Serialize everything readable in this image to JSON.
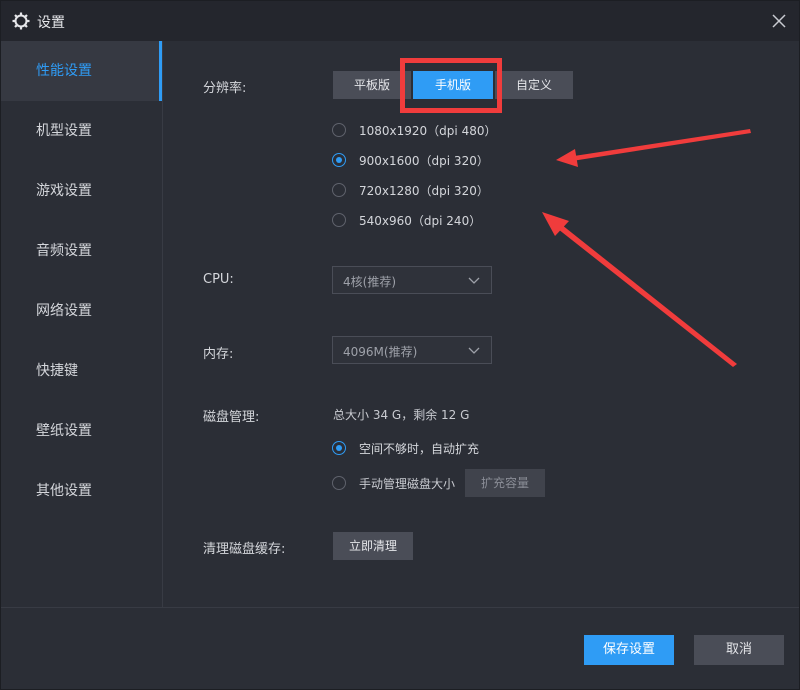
{
  "window": {
    "title": "设置"
  },
  "sidebar": {
    "items": [
      {
        "label": "性能设置",
        "active": true
      },
      {
        "label": "机型设置"
      },
      {
        "label": "游戏设置"
      },
      {
        "label": "音频设置"
      },
      {
        "label": "网络设置"
      },
      {
        "label": "快捷键"
      },
      {
        "label": "壁纸设置"
      },
      {
        "label": "其他设置"
      }
    ]
  },
  "resolution": {
    "label": "分辨率:",
    "modes": [
      "平板版",
      "手机版",
      "自定义"
    ],
    "selected_mode": "手机版",
    "options": [
      {
        "label": "1080x1920（dpi 480）",
        "checked": false
      },
      {
        "label": "900x1600（dpi 320）",
        "checked": true
      },
      {
        "label": "720x1280（dpi 320）",
        "checked": false
      },
      {
        "label": "540x960（dpi 240）",
        "checked": false
      }
    ]
  },
  "cpu": {
    "label": "CPU:",
    "value": "4核(推荐)"
  },
  "memory": {
    "label": "内存:",
    "value": "4096M(推荐)"
  },
  "disk": {
    "label": "磁盘管理:",
    "info": "总大小 34 G，剩余 12 G",
    "options": [
      {
        "label": "空间不够时，自动扩充",
        "checked": true
      },
      {
        "label": "手动管理磁盘大小",
        "checked": false
      }
    ],
    "expand_button": "扩充容量"
  },
  "cache": {
    "label": "清理磁盘缓存:",
    "button": "立即清理"
  },
  "footer": {
    "save": "保存设置",
    "cancel": "取消"
  },
  "colors": {
    "accent": "#2f9cf5",
    "annotation": "#f03c3c",
    "background": "#2b2e36"
  }
}
